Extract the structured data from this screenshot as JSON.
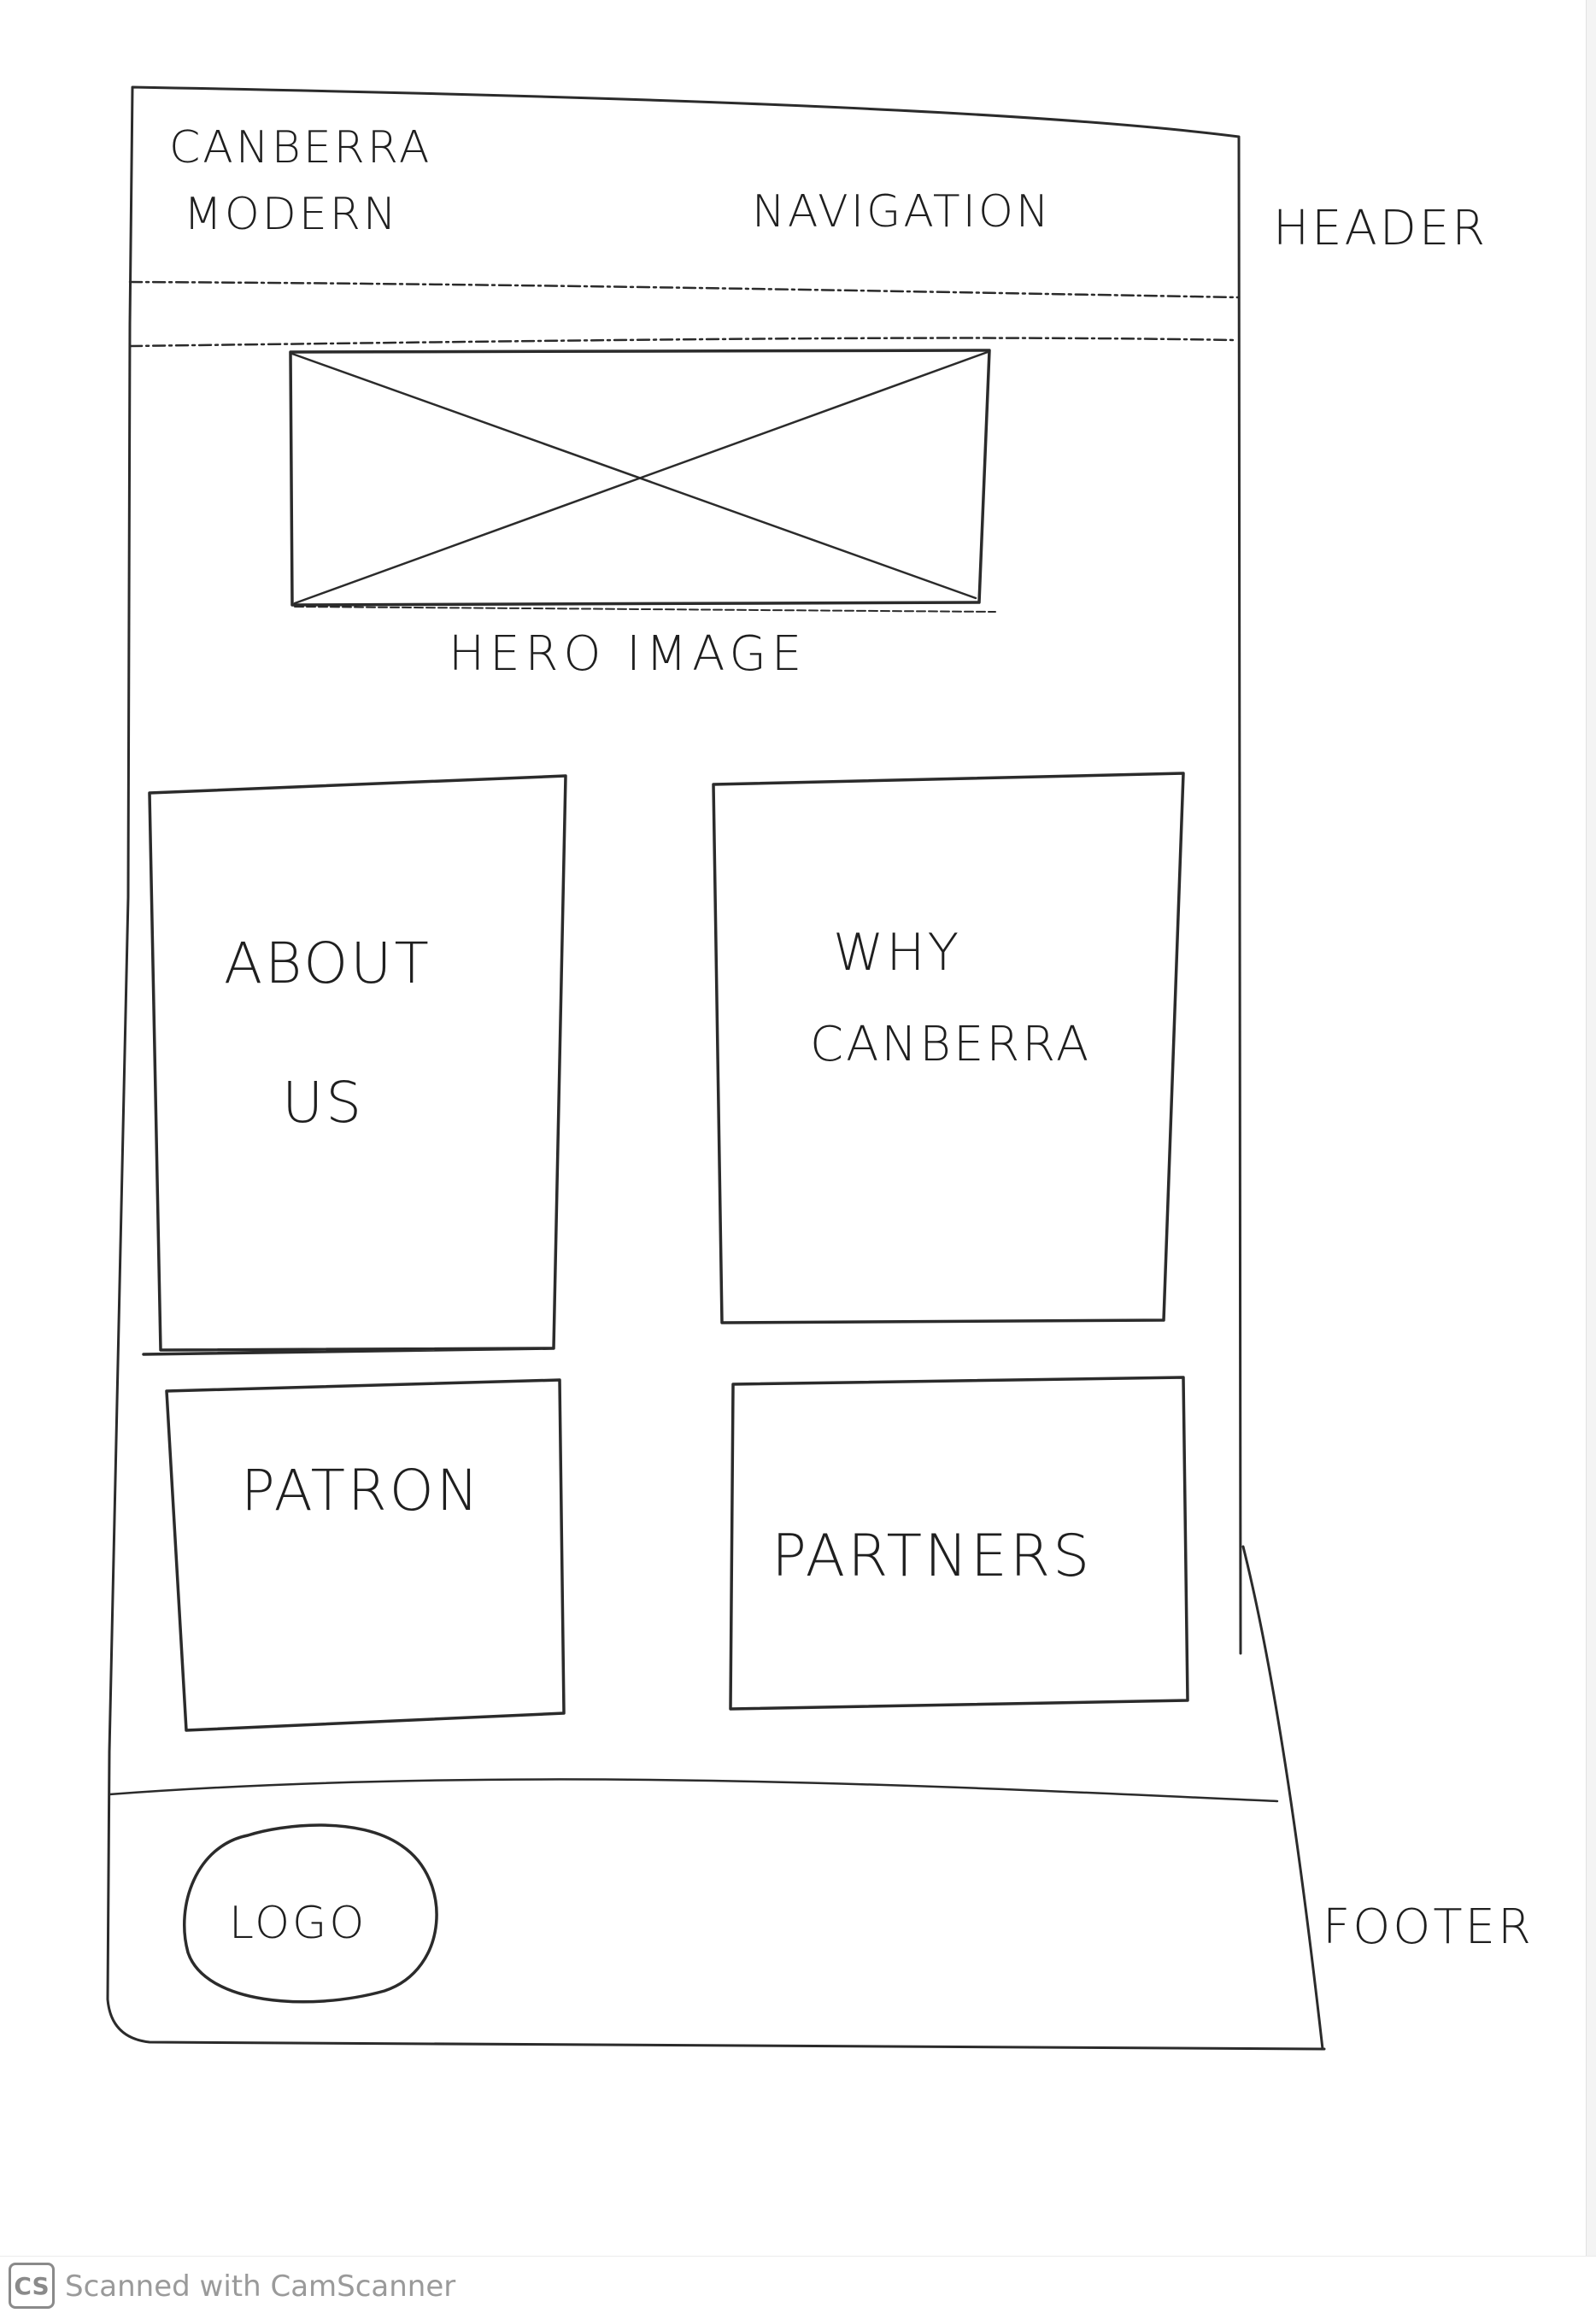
{
  "wireframe": {
    "header": {
      "brand_line1": "CANBERRA",
      "brand_line2": "MODERN",
      "navigation": "NAVIGATION",
      "annotation": "HEADER"
    },
    "hero": {
      "caption": "HERO IMAGE"
    },
    "cards": {
      "about_line1": "ABOUT",
      "about_line2": "US",
      "why_line1": "WHY",
      "why_line2": "CANBERRA",
      "patron": "PATRON",
      "partners": "PARTNERS"
    },
    "footer": {
      "logo": "LOGO",
      "annotation": "FOOTER"
    }
  },
  "scanner": {
    "badge": "CS",
    "text": "Scanned with CamScanner"
  }
}
